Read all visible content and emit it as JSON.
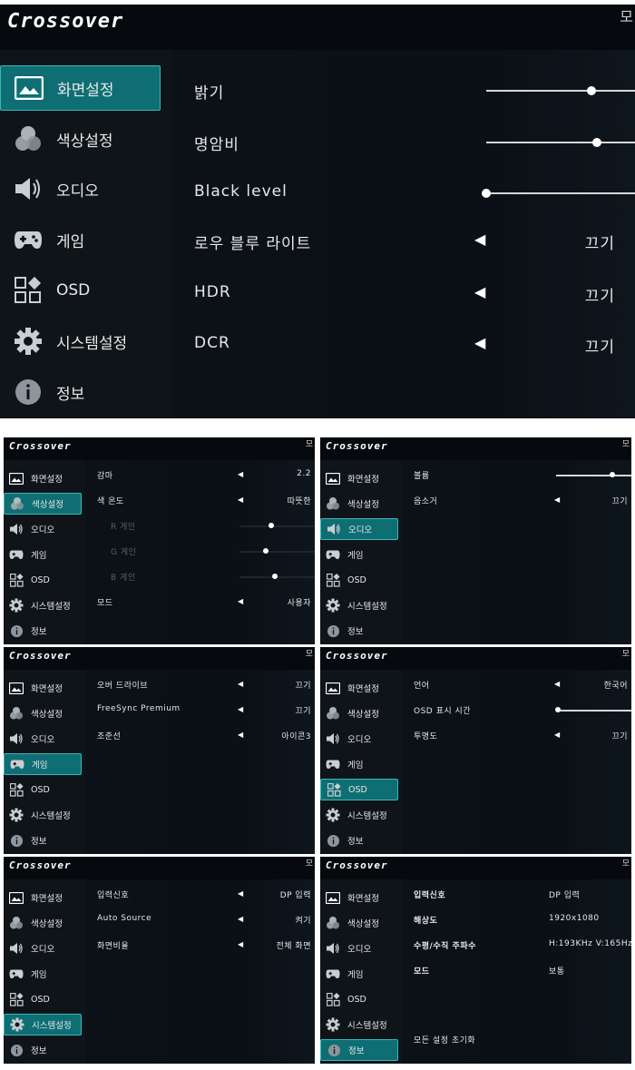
{
  "brand": "Crossover",
  "menu": [
    "화면설정",
    "색상설정",
    "오디오",
    "게임",
    "OSD",
    "시스템설정",
    "정보"
  ],
  "edge_glyph": "모",
  "screen_main": {
    "rows": [
      {
        "label": "밝기",
        "type": "slider",
        "level": 0.82
      },
      {
        "label": "명암비",
        "type": "slider",
        "level": 0.86
      },
      {
        "label": "Black level",
        "type": "slider",
        "level": 0.0
      },
      {
        "label": "로우 블루 라이트",
        "type": "select",
        "value": "끄기"
      },
      {
        "label": "HDR",
        "type": "select",
        "value": "끄기"
      },
      {
        "label": "DCR",
        "type": "select",
        "value": "끄기"
      }
    ]
  },
  "color": {
    "rows": [
      {
        "label": "감마",
        "type": "select",
        "value": "2.2"
      },
      {
        "label": "색 온도",
        "type": "select",
        "value": "따뜻한"
      },
      {
        "label": "R 게인",
        "type": "slider",
        "level": 0.5,
        "disabled": true
      },
      {
        "label": "G 게인",
        "type": "slider",
        "level": 0.42,
        "disabled": true
      },
      {
        "label": "B 게인",
        "type": "slider",
        "level": 0.55,
        "disabled": true
      },
      {
        "label": "모드",
        "type": "select",
        "value": "사용자"
      }
    ]
  },
  "audio": {
    "rows": [
      {
        "label": "볼륨",
        "type": "slider",
        "level": 0.88
      },
      {
        "label": "음소거",
        "type": "select",
        "value": "끄기"
      }
    ]
  },
  "game": {
    "rows": [
      {
        "label": "오버 드라이브",
        "type": "select",
        "value": "끄기"
      },
      {
        "label": "FreeSync Premium",
        "type": "select",
        "value": "끄기"
      },
      {
        "label": "조준선",
        "type": "select",
        "value": "아이콘3"
      }
    ]
  },
  "osd": {
    "rows": [
      {
        "label": "언어",
        "type": "select",
        "value": "한국어"
      },
      {
        "label": "OSD 표시 시간",
        "type": "slider",
        "level": 0.03
      },
      {
        "label": "투명도",
        "type": "select",
        "value": "끄기"
      }
    ]
  },
  "system": {
    "rows": [
      {
        "label": "입력신호",
        "type": "select",
        "value": "DP 입력"
      },
      {
        "label": "Auto Source",
        "type": "select",
        "value": "켜기"
      },
      {
        "label": "화면비율",
        "type": "select",
        "value": "전체 화면"
      }
    ]
  },
  "info": {
    "rows": [
      {
        "label": "입력신호",
        "value": "DP 입력"
      },
      {
        "label": "해상도",
        "value": "1920x1080"
      },
      {
        "label": "수평/수직 주파수",
        "value": "H:193KHz V:165Hz"
      },
      {
        "label": "모드",
        "value": "보통"
      }
    ],
    "reset": "모든 설정 초기화"
  },
  "colors": {
    "selected": "#0e6e73",
    "selected_border": "#3ab7b8",
    "bg": "#06090d",
    "sidebar": "#0f1419"
  }
}
